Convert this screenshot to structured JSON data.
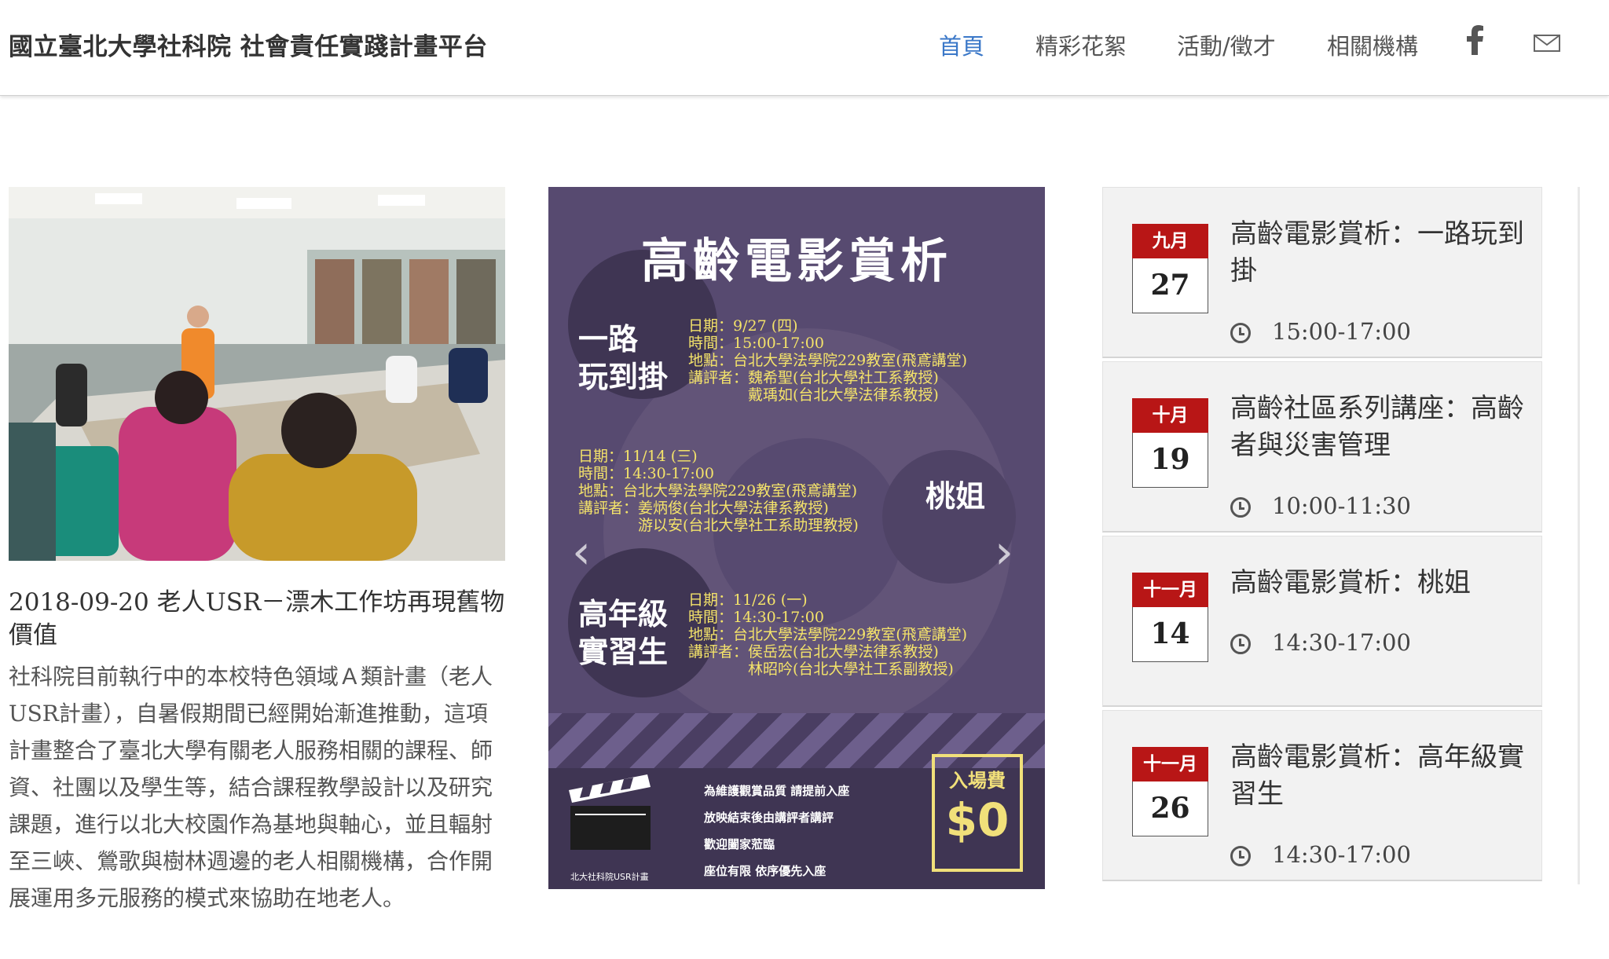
{
  "header": {
    "brand": "國立臺北大學社科院  社會責任實踐計畫平台",
    "nav": [
      {
        "label": "首頁",
        "active": true
      },
      {
        "label": "精彩花絮",
        "active": false
      },
      {
        "label": "活動/徵才",
        "active": false
      },
      {
        "label": "相關機構",
        "active": false
      }
    ],
    "icons": [
      "facebook-icon",
      "mail-icon"
    ],
    "accent_color": "#3b78c8"
  },
  "article": {
    "title": "2018-09-20 老人USR－漂木工作坊再現舊物價值",
    "body": "社科院目前執行中的本校特色領域Ａ類計畫（老人USR計畫），自暑假期間已經開始漸進推動，這項計畫整合了臺北大學有關老人服務相關的課程、師資、社團以及學生等，結合課程教學設計以及研究課題，進行以北大校園作為基地與軸心，並且輻射至三峽、鶯歌與樹林週邊的老人相關機構，合作開展運用多元服務的模式來協助在地老人。"
  },
  "poster": {
    "title": "高齡電影賞析",
    "films": [
      {
        "name_line1": "一路",
        "name_line2": "玩到掛",
        "info": [
          "日期：9/27 (四)",
          "時間：15:00-17:00",
          "地點：台北大學法學院229教室(飛鳶講堂)",
          "講評者：魏希聖(台北大學社工系教授)",
          "　　　　戴瑀如(台北大學法律系教授)"
        ]
      },
      {
        "name_line1": "桃姐",
        "name_line2": "",
        "info": [
          "日期：11/14 (三)",
          "時間：14:30-17:00",
          "地點：台北大學法學院229教室(飛鳶講堂)",
          "講評者：姜炳俊(台北大學法律系教授)",
          "　　　　游以安(台北大學社工系助理教授)"
        ]
      },
      {
        "name_line1": "高年級",
        "name_line2": "實習生",
        "info": [
          "日期：11/26 (一)",
          "時間：14:30-17:00",
          "地點：台北大學法學院229教室(飛鳶講堂)",
          "講評者：侯岳宏(台北大學法律系教授)",
          "　　　　林昭吟(台北大學社工系副教授)"
        ]
      }
    ],
    "notices": [
      "為維護觀賞品質  請提前入座",
      "放映結束後由講評者講評",
      "歡迎闔家蒞臨",
      "座位有限  依序優先入座"
    ],
    "fee_label": "入場費",
    "fee_value": "$0",
    "organizer": "北大社科院USR計畫",
    "prev_arrow": "‹",
    "next_arrow": "›"
  },
  "events": [
    {
      "month": "九月",
      "day": "27",
      "title": "高齡電影賞析：一路玩到掛",
      "time": "15:00-17:00"
    },
    {
      "month": "十月",
      "day": "19",
      "title": "高齡社區系列講座：高齡者與災害管理",
      "time": "10:00-11:30"
    },
    {
      "month": "十一月",
      "day": "14",
      "title": "高齡電影賞析：桃姐",
      "time": "14:30-17:00"
    },
    {
      "month": "十一月",
      "day": "26",
      "title": "高齡電影賞析：高年級實習生",
      "time": "14:30-17:00"
    }
  ]
}
